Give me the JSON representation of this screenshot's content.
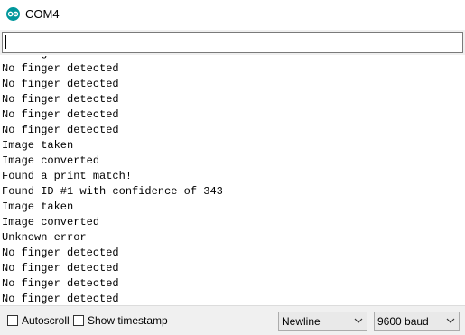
{
  "window": {
    "title": "COM4",
    "icon": "arduino-logo-icon",
    "accent": "#00979c"
  },
  "send": {
    "value": ""
  },
  "output": {
    "lines": [
      "No finger detected",
      "No finger detected",
      "No finger detected",
      "No finger detected",
      "No finger detected",
      "No finger detected",
      "Image taken",
      "Image converted",
      "Found a print match!",
      "Found ID #1 with confidence of 343",
      "Image taken",
      "Image converted",
      "Unknown error",
      "No finger detected",
      "No finger detected",
      "No finger detected",
      "No finger detected"
    ]
  },
  "footer": {
    "autoscroll_label": "Autoscroll",
    "autoscroll_checked": false,
    "timestamp_label": "Show timestamp",
    "timestamp_checked": false,
    "line_ending": "Newline",
    "baud_rate": "9600 baud"
  }
}
